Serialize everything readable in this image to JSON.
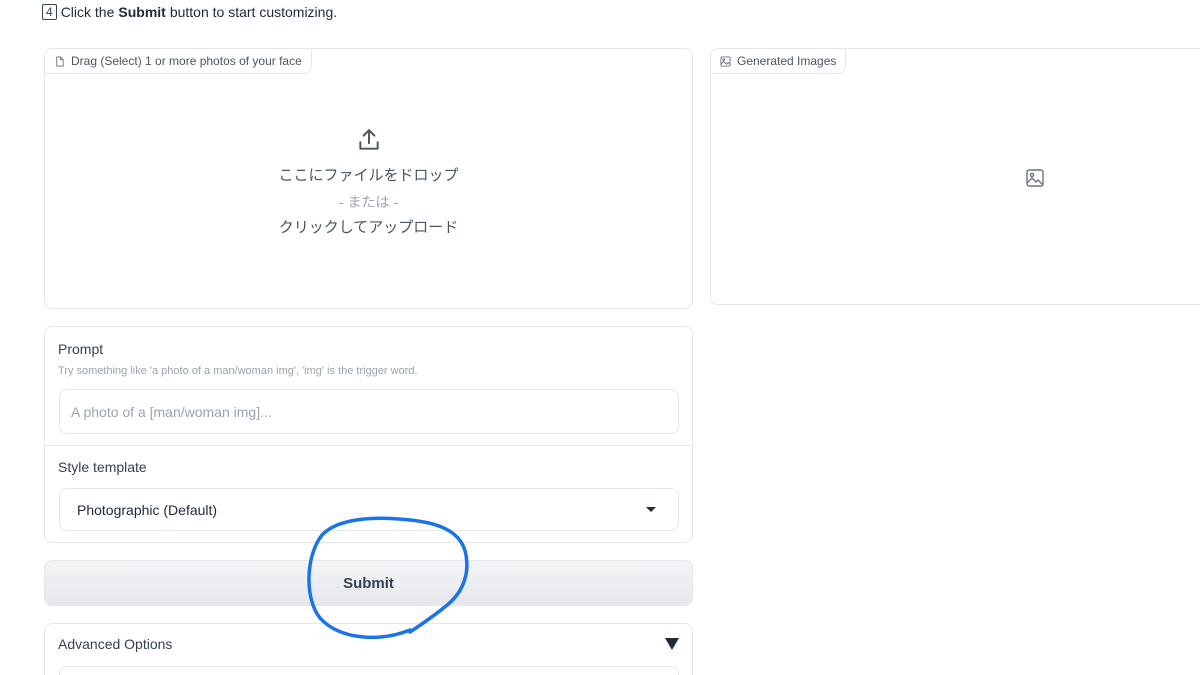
{
  "instruction": {
    "step": "4",
    "text_before": "Click the ",
    "bold": "Submit",
    "text_after": " button to start customizing."
  },
  "upload": {
    "label": "Drag (Select) 1 or more photos of your face",
    "drop_text": "ここにファイルをドロップ",
    "or_text": "- または -",
    "click_text": "クリックしてアップロード",
    "icon": "upload-icon"
  },
  "gallery": {
    "label": "Generated Images",
    "icon": "image-icon"
  },
  "prompt": {
    "title": "Prompt",
    "info": "Try something like 'a photo of a man/woman img', 'img' is the trigger word.",
    "placeholder": "A photo of a [man/woman img]...",
    "value": ""
  },
  "style": {
    "title": "Style template",
    "selected": "Photographic (Default)"
  },
  "submit": {
    "label": "Submit"
  },
  "advanced": {
    "label": "Advanced Options"
  },
  "colors": {
    "annotation": "#1a73e8",
    "border": "#e5e7eb"
  }
}
